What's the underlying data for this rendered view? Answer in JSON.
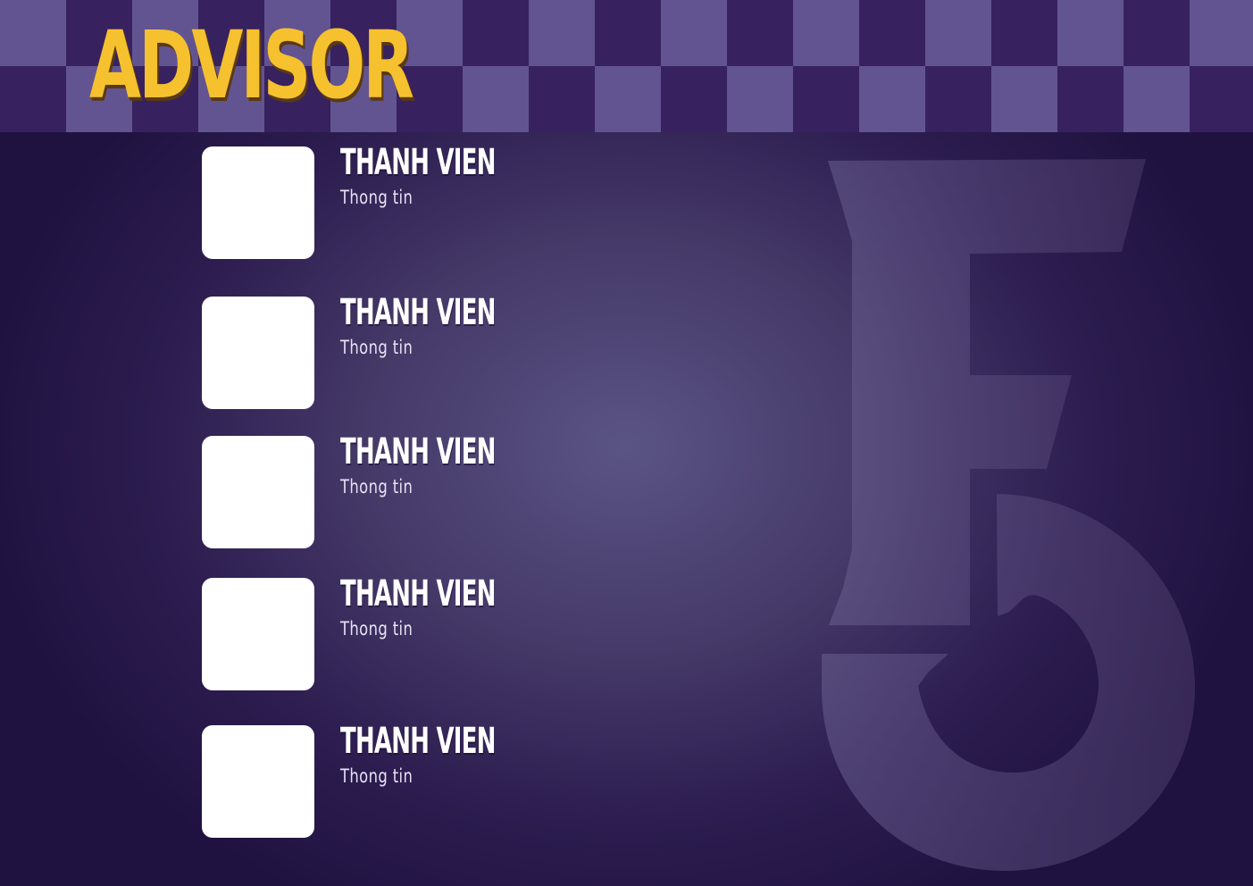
{
  "header": {
    "title": "ADVISOR"
  },
  "colors": {
    "background": "#1f1240",
    "checker_light": "#625491",
    "checker_dark": "#38215f",
    "title": "#f6c12e",
    "avatar": "#ffffff",
    "logo": "#5a4f7d"
  },
  "members": [
    {
      "name": "THANH VIEN",
      "info": "Thong tin"
    },
    {
      "name": "THANH VIEN",
      "info": "Thong tin"
    },
    {
      "name": "THANH VIEN",
      "info": "Thong tin"
    },
    {
      "name": "THANH VIEN",
      "info": "Thong tin"
    },
    {
      "name": "THANH VIEN",
      "info": "Thong tin"
    }
  ],
  "logo": {
    "icon": "f5-logo-icon"
  }
}
